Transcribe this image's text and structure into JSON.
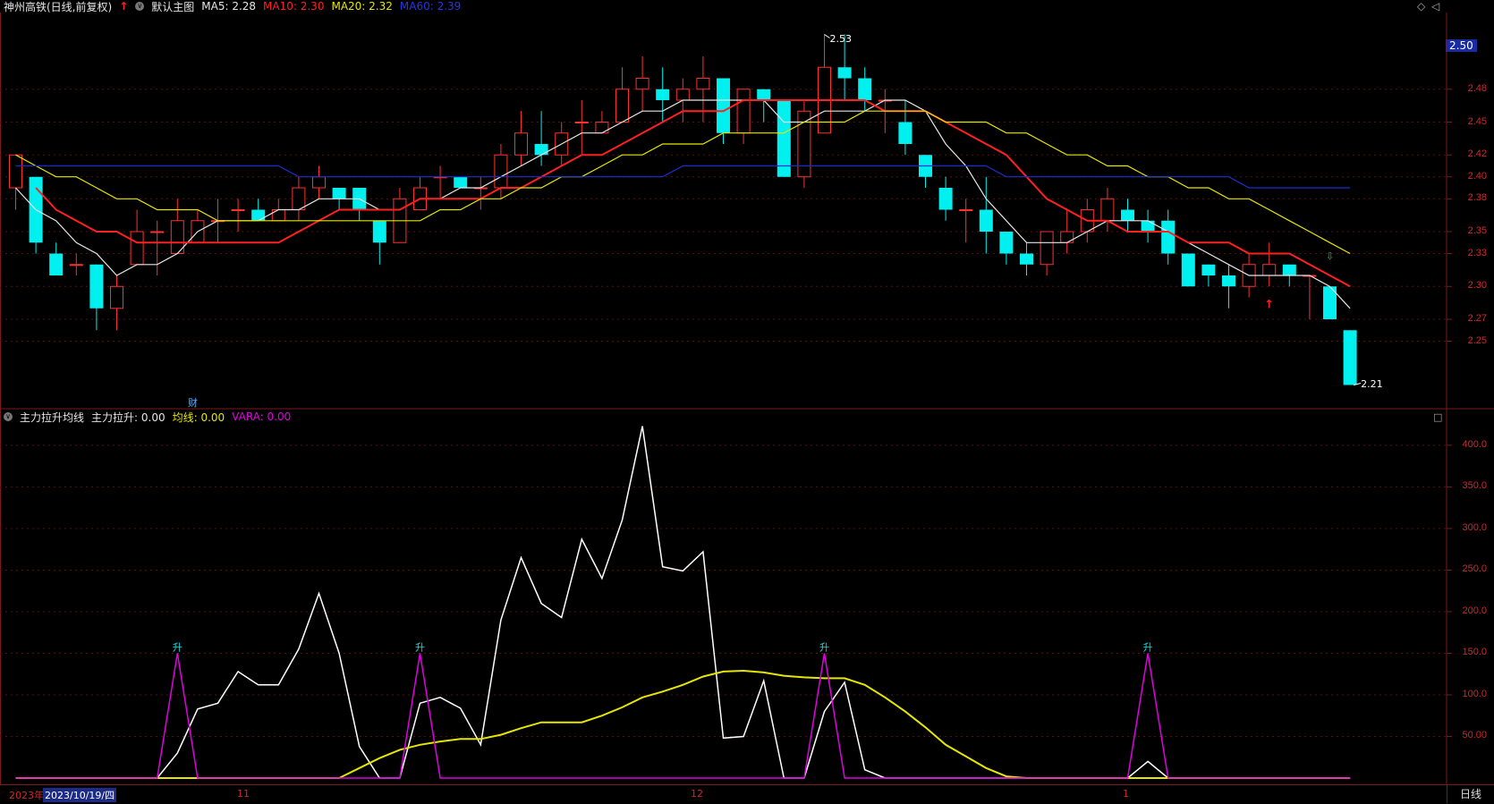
{
  "header": {
    "title": "神州高铁(日线,前复权)",
    "template": "默认主图",
    "ma5": "MA5: 2.28",
    "ma10": "MA10: 2.30",
    "ma20": "MA20: 2.32",
    "ma60": "MA60: 2.39",
    "ma5_color": "#e6e6e6",
    "ma10_color": "#ff2020",
    "ma20_color": "#e6e600",
    "ma60_color": "#1e2ccf"
  },
  "main_axis": {
    "current_price": "2.50",
    "ticks": [
      "2.48",
      "2.45",
      "2.42",
      "2.40",
      "2.38",
      "2.35",
      "2.33",
      "2.30",
      "2.27",
      "2.25"
    ],
    "high_label": "2.53",
    "low_label": "2.21",
    "fin_label": "财"
  },
  "sub": {
    "title": "主力拉升均线",
    "field1": "主力拉升: 0.00",
    "field2": "均线: 0.00",
    "field3": "VARA: 0.00",
    "ticks": [
      "400.0",
      "350.0",
      "300.0",
      "250.0",
      "200.0",
      "150.0",
      "100.0",
      "50.00"
    ],
    "signal_label": "升"
  },
  "bottom": {
    "year": "2023年",
    "selected_date": "2023/10/19/四",
    "month_11": "11",
    "month_12": "12",
    "month_1": "1",
    "period": "日线"
  },
  "chart_data": [
    {
      "type": "candlestick",
      "ylim": [
        2.19,
        2.55
      ],
      "candles": [
        [
          2.39,
          2.42,
          2.42,
          2.37
        ],
        [
          2.4,
          2.34,
          2.4,
          2.33
        ],
        [
          2.33,
          2.31,
          2.34,
          2.31
        ],
        [
          2.32,
          2.32,
          2.33,
          2.31
        ],
        [
          2.32,
          2.28,
          2.32,
          2.26
        ],
        [
          2.28,
          2.3,
          2.31,
          2.26
        ],
        [
          2.32,
          2.35,
          2.37,
          2.32
        ],
        [
          2.35,
          2.35,
          2.36,
          2.31
        ],
        [
          2.33,
          2.36,
          2.38,
          2.33
        ],
        [
          2.34,
          2.36,
          2.37,
          2.34
        ],
        [
          2.36,
          2.36,
          2.38,
          2.34
        ],
        [
          2.37,
          2.37,
          2.38,
          2.35
        ],
        [
          2.37,
          2.36,
          2.38,
          2.36
        ],
        [
          2.36,
          2.37,
          2.38,
          2.36
        ],
        [
          2.37,
          2.39,
          2.4,
          2.36
        ],
        [
          2.39,
          2.4,
          2.41,
          2.38
        ],
        [
          2.39,
          2.38,
          2.39,
          2.37
        ],
        [
          2.39,
          2.37,
          2.39,
          2.36
        ],
        [
          2.36,
          2.34,
          2.36,
          2.32
        ],
        [
          2.34,
          2.38,
          2.39,
          2.34
        ],
        [
          2.37,
          2.39,
          2.4,
          2.37
        ],
        [
          2.4,
          2.4,
          2.41,
          2.38
        ],
        [
          2.4,
          2.39,
          2.4,
          2.39
        ],
        [
          2.39,
          2.39,
          2.4,
          2.37
        ],
        [
          2.39,
          2.42,
          2.43,
          2.38
        ],
        [
          2.42,
          2.44,
          2.46,
          2.41
        ],
        [
          2.43,
          2.42,
          2.46,
          2.41
        ],
        [
          2.42,
          2.44,
          2.45,
          2.41
        ],
        [
          2.45,
          2.45,
          2.47,
          2.42
        ],
        [
          2.44,
          2.45,
          2.46,
          2.44
        ],
        [
          2.45,
          2.48,
          2.5,
          2.45
        ],
        [
          2.48,
          2.49,
          2.51,
          2.46
        ],
        [
          2.48,
          2.47,
          2.5,
          2.45
        ],
        [
          2.47,
          2.48,
          2.49,
          2.45
        ],
        [
          2.48,
          2.49,
          2.51,
          2.45
        ],
        [
          2.49,
          2.44,
          2.49,
          2.43
        ],
        [
          2.44,
          2.48,
          2.48,
          2.43
        ],
        [
          2.48,
          2.47,
          2.48,
          2.45
        ],
        [
          2.47,
          2.4,
          2.47,
          2.4
        ],
        [
          2.4,
          2.46,
          2.47,
          2.39
        ],
        [
          2.44,
          2.5,
          2.53,
          2.44
        ],
        [
          2.5,
          2.49,
          2.53,
          2.47
        ],
        [
          2.49,
          2.47,
          2.5,
          2.46
        ],
        [
          2.47,
          2.47,
          2.48,
          2.44
        ],
        [
          2.45,
          2.43,
          2.47,
          2.42
        ],
        [
          2.42,
          2.4,
          2.42,
          2.39
        ],
        [
          2.39,
          2.37,
          2.4,
          2.36
        ],
        [
          2.37,
          2.37,
          2.38,
          2.34
        ],
        [
          2.37,
          2.35,
          2.4,
          2.33
        ],
        [
          2.35,
          2.33,
          2.35,
          2.32
        ],
        [
          2.33,
          2.32,
          2.34,
          2.31
        ],
        [
          2.32,
          2.35,
          2.35,
          2.31
        ],
        [
          2.34,
          2.35,
          2.37,
          2.33
        ],
        [
          2.35,
          2.37,
          2.38,
          2.34
        ],
        [
          2.36,
          2.38,
          2.39,
          2.35
        ],
        [
          2.37,
          2.36,
          2.38,
          2.35
        ],
        [
          2.36,
          2.35,
          2.37,
          2.34
        ],
        [
          2.36,
          2.33,
          2.37,
          2.32
        ],
        [
          2.33,
          2.3,
          2.33,
          2.3
        ],
        [
          2.32,
          2.31,
          2.32,
          2.3
        ],
        [
          2.31,
          2.3,
          2.32,
          2.28
        ],
        [
          2.3,
          2.32,
          2.33,
          2.29
        ],
        [
          2.31,
          2.32,
          2.34,
          2.3
        ],
        [
          2.32,
          2.31,
          2.32,
          2.3
        ],
        [
          2.31,
          2.31,
          2.31,
          2.27
        ],
        [
          2.3,
          2.27,
          2.3,
          2.27
        ],
        [
          2.26,
          2.21,
          2.26,
          2.21
        ]
      ],
      "series": [
        {
          "name": "MA5",
          "color": "#e6e6e6",
          "values": [
            2.39,
            2.37,
            2.36,
            2.34,
            2.33,
            2.31,
            2.32,
            2.32,
            2.33,
            2.35,
            2.36,
            2.36,
            2.36,
            2.37,
            2.37,
            2.38,
            2.38,
            2.38,
            2.37,
            2.37,
            2.38,
            2.38,
            2.39,
            2.39,
            2.4,
            2.41,
            2.42,
            2.43,
            2.44,
            2.44,
            2.45,
            2.46,
            2.46,
            2.47,
            2.47,
            2.47,
            2.47,
            2.47,
            2.45,
            2.45,
            2.46,
            2.46,
            2.46,
            2.47,
            2.47,
            2.46,
            2.43,
            2.41,
            2.38,
            2.36,
            2.34,
            2.34,
            2.34,
            2.35,
            2.36,
            2.36,
            2.36,
            2.35,
            2.34,
            2.33,
            2.32,
            2.31,
            2.31,
            2.31,
            2.31,
            2.3,
            2.28
          ]
        },
        {
          "name": "MA10",
          "color": "#ff2020",
          "values": [
            null,
            2.39,
            2.37,
            2.36,
            2.35,
            2.35,
            2.34,
            2.34,
            2.34,
            2.34,
            2.34,
            2.34,
            2.34,
            2.34,
            2.35,
            2.36,
            2.37,
            2.37,
            2.37,
            2.37,
            2.38,
            2.38,
            2.38,
            2.38,
            2.39,
            2.39,
            2.4,
            2.41,
            2.42,
            2.42,
            2.43,
            2.44,
            2.45,
            2.46,
            2.46,
            2.46,
            2.47,
            2.47,
            2.47,
            2.47,
            2.47,
            2.47,
            2.47,
            2.46,
            2.46,
            2.46,
            2.45,
            2.44,
            2.43,
            2.42,
            2.4,
            2.38,
            2.37,
            2.36,
            2.36,
            2.35,
            2.35,
            2.35,
            2.34,
            2.34,
            2.34,
            2.33,
            2.33,
            2.33,
            2.32,
            2.31,
            2.3
          ]
        },
        {
          "name": "MA20",
          "color": "#e6e600",
          "values": [
            2.42,
            2.41,
            2.4,
            2.4,
            2.39,
            2.38,
            2.38,
            2.37,
            2.37,
            2.37,
            2.36,
            2.36,
            2.36,
            2.36,
            2.36,
            2.36,
            2.36,
            2.36,
            2.36,
            2.36,
            2.36,
            2.37,
            2.37,
            2.38,
            2.38,
            2.39,
            2.39,
            2.4,
            2.4,
            2.41,
            2.42,
            2.42,
            2.43,
            2.43,
            2.43,
            2.44,
            2.44,
            2.44,
            2.44,
            2.45,
            2.45,
            2.45,
            2.46,
            2.46,
            2.46,
            2.46,
            2.45,
            2.45,
            2.45,
            2.44,
            2.44,
            2.43,
            2.42,
            2.42,
            2.41,
            2.41,
            2.4,
            2.4,
            2.39,
            2.39,
            2.38,
            2.38,
            2.37,
            2.36,
            2.35,
            2.34,
            2.33
          ]
        },
        {
          "name": "MA60",
          "color": "#1e2ccf",
          "values": [
            2.41,
            2.41,
            2.41,
            2.41,
            2.41,
            2.41,
            2.41,
            2.41,
            2.41,
            2.41,
            2.41,
            2.41,
            2.41,
            2.41,
            2.4,
            2.4,
            2.4,
            2.4,
            2.4,
            2.4,
            2.4,
            2.4,
            2.4,
            2.4,
            2.4,
            2.4,
            2.4,
            2.4,
            2.4,
            2.4,
            2.4,
            2.4,
            2.4,
            2.41,
            2.41,
            2.41,
            2.41,
            2.41,
            2.41,
            2.41,
            2.41,
            2.41,
            2.41,
            2.41,
            2.41,
            2.41,
            2.41,
            2.41,
            2.41,
            2.4,
            2.4,
            2.4,
            2.4,
            2.4,
            2.4,
            2.4,
            2.4,
            2.4,
            2.4,
            2.4,
            2.4,
            2.39,
            2.39,
            2.39,
            2.39,
            2.39,
            2.39
          ]
        }
      ]
    },
    {
      "type": "line",
      "ylim": [
        0,
        430
      ],
      "series": [
        {
          "name": "主力拉升",
          "color": "#ffffff",
          "values": [
            0,
            0,
            0,
            0,
            0,
            0,
            0,
            0,
            30,
            83,
            90,
            128,
            112,
            112,
            155,
            222,
            150,
            38,
            0,
            0,
            90,
            97,
            84,
            40,
            190,
            265,
            210,
            193,
            287,
            240,
            310,
            423,
            254,
            249,
            272,
            48,
            50,
            117,
            0,
            0,
            80,
            115,
            10,
            0,
            0,
            0,
            0,
            0,
            0,
            0,
            0,
            0,
            0,
            0,
            0,
            0,
            20,
            0,
            0,
            0,
            0,
            0,
            0,
            0,
            0,
            0,
            0
          ]
        },
        {
          "name": "均线",
          "color": "#e6e600",
          "values": [
            0,
            0,
            0,
            0,
            0,
            0,
            0,
            0,
            0,
            0,
            0,
            0,
            0,
            0,
            0,
            0,
            0,
            12,
            24,
            34,
            40,
            44,
            47,
            47,
            52,
            60,
            67,
            67,
            67,
            75,
            85,
            97,
            104,
            112,
            122,
            128,
            129,
            127,
            123,
            121,
            120,
            120,
            112,
            97,
            80,
            61,
            40,
            26,
            12,
            2,
            0,
            0,
            0,
            0,
            0,
            0,
            0,
            0,
            0,
            0,
            0,
            0,
            0,
            0,
            0,
            0,
            0
          ]
        },
        {
          "name": "VARA",
          "color": "#e000e0",
          "values": [
            0,
            0,
            0,
            0,
            0,
            0,
            0,
            0,
            150,
            0,
            0,
            0,
            0,
            0,
            0,
            0,
            0,
            0,
            0,
            0,
            150,
            0,
            0,
            0,
            0,
            0,
            0,
            0,
            0,
            0,
            0,
            0,
            0,
            0,
            0,
            0,
            0,
            0,
            0,
            0,
            150,
            0,
            0,
            0,
            0,
            0,
            0,
            0,
            0,
            0,
            0,
            0,
            0,
            0,
            0,
            0,
            150,
            0,
            0,
            0,
            0,
            0,
            0,
            0,
            0,
            0,
            0
          ]
        }
      ],
      "signals": [
        8,
        20,
        40,
        56
      ]
    }
  ]
}
